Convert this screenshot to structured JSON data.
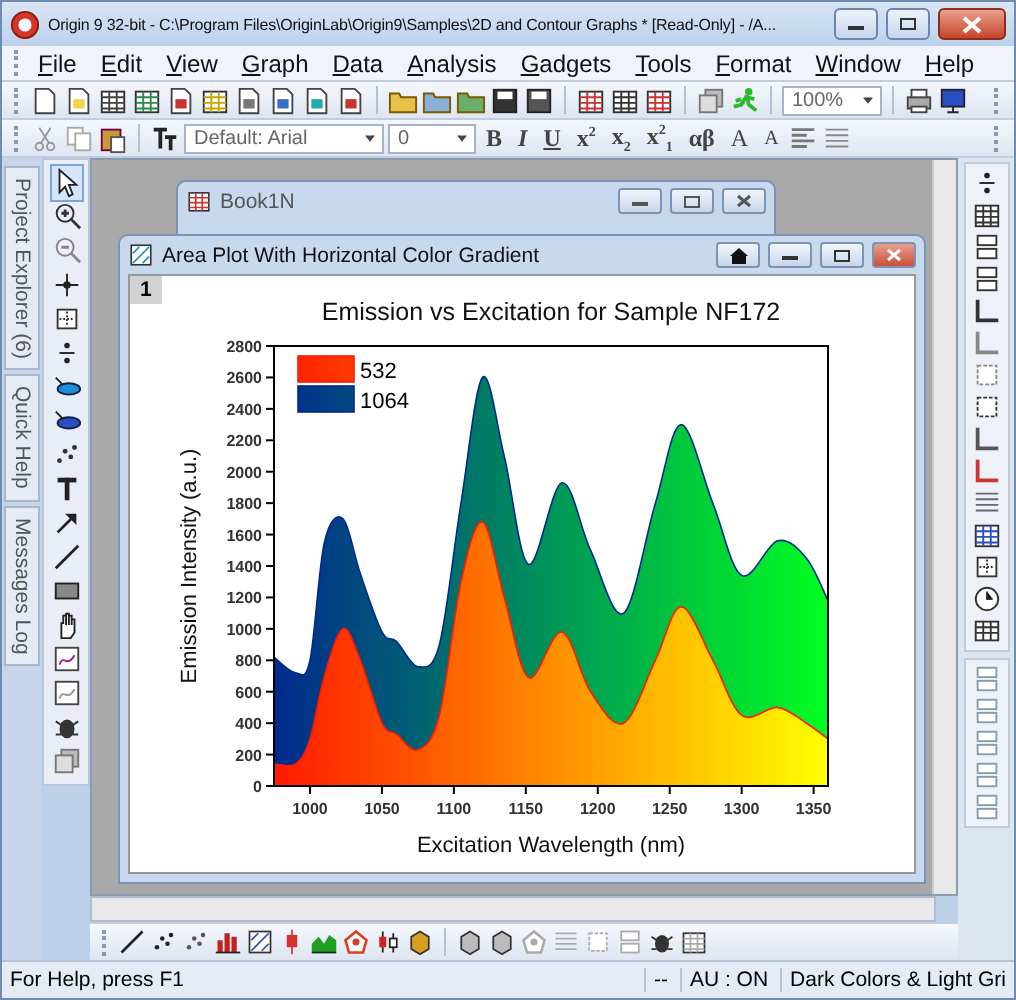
{
  "window": {
    "title": "Origin 9 32-bit - C:\\Program Files\\OriginLab\\Origin9\\Samples\\2D and Contour Graphs * [Read-Only] - /A..."
  },
  "menu": [
    "File",
    "Edit",
    "View",
    "Graph",
    "Data",
    "Analysis",
    "Gadgets",
    "Tools",
    "Format",
    "Window",
    "Help"
  ],
  "standard_toolbar": {
    "zoom": "100%"
  },
  "format_toolbar": {
    "font": "Default: Arial",
    "size": "0",
    "buttons": [
      {
        "label": "B",
        "kind": "bold"
      },
      {
        "label": "I",
        "kind": "italic"
      },
      {
        "label": "U",
        "kind": "underline"
      },
      {
        "label": "x$^{2}$",
        "kind": "superscript"
      },
      {
        "label": "x$_{2}$",
        "kind": "subscript"
      },
      {
        "label": "x$^{2}$$_{1}$",
        "kind": "supersubscript"
      },
      {
        "label": "αβ",
        "kind": "greek"
      },
      {
        "label": "A",
        "kind": "grow-font"
      },
      {
        "label": "A",
        "kind": "shrink-font"
      }
    ]
  },
  "side_tabs": [
    "Project Explorer (6)",
    "Quick Help",
    "Messages Log"
  ],
  "book_window": {
    "title": "Book1N"
  },
  "graph_window": {
    "title": "Area Plot With Horizontal Color Gradient",
    "layer": "1",
    "chart_data": {
      "type": "area",
      "title": "Emission vs Excitation for Sample NF172",
      "xlabel": "Excitation Wavelength (nm)",
      "ylabel": "Emission Intensity (a.u.)",
      "x": [
        975,
        990,
        1000,
        1010,
        1023,
        1035,
        1050,
        1060,
        1075,
        1090,
        1105,
        1120,
        1135,
        1152,
        1175,
        1195,
        1218,
        1240,
        1258,
        1280,
        1300,
        1325,
        1345,
        1360
      ],
      "series": [
        {
          "name": "532",
          "color": "#ff1a00",
          "values": [
            140,
            140,
            300,
            700,
            1000,
            800,
            400,
            330,
            230,
            450,
            1300,
            1680,
            1200,
            690,
            980,
            600,
            400,
            800,
            1140,
            800,
            450,
            500,
            400,
            300
          ]
        },
        {
          "name": "1064",
          "color": "#002a8f",
          "values": [
            820,
            720,
            800,
            1550,
            1700,
            1350,
            980,
            920,
            760,
            900,
            1800,
            2600,
            2100,
            1410,
            1930,
            1500,
            1100,
            1800,
            2300,
            1800,
            1340,
            1560,
            1450,
            1180
          ]
        }
      ],
      "legend": "upper left",
      "xlim": [
        975,
        1360
      ],
      "ylim": [
        0,
        2800
      ],
      "xticks": [
        1000,
        1050,
        1100,
        1150,
        1200,
        1250,
        1300,
        1350
      ],
      "yticks": [
        0,
        200,
        400,
        600,
        800,
        1000,
        1200,
        1400,
        1600,
        1800,
        2000,
        2200,
        2400,
        2600,
        2800
      ]
    }
  },
  "status_bar": {
    "help": "For Help, press F1",
    "fields": [
      "--",
      "AU : ON",
      "Dark Colors & Light Gri"
    ]
  }
}
